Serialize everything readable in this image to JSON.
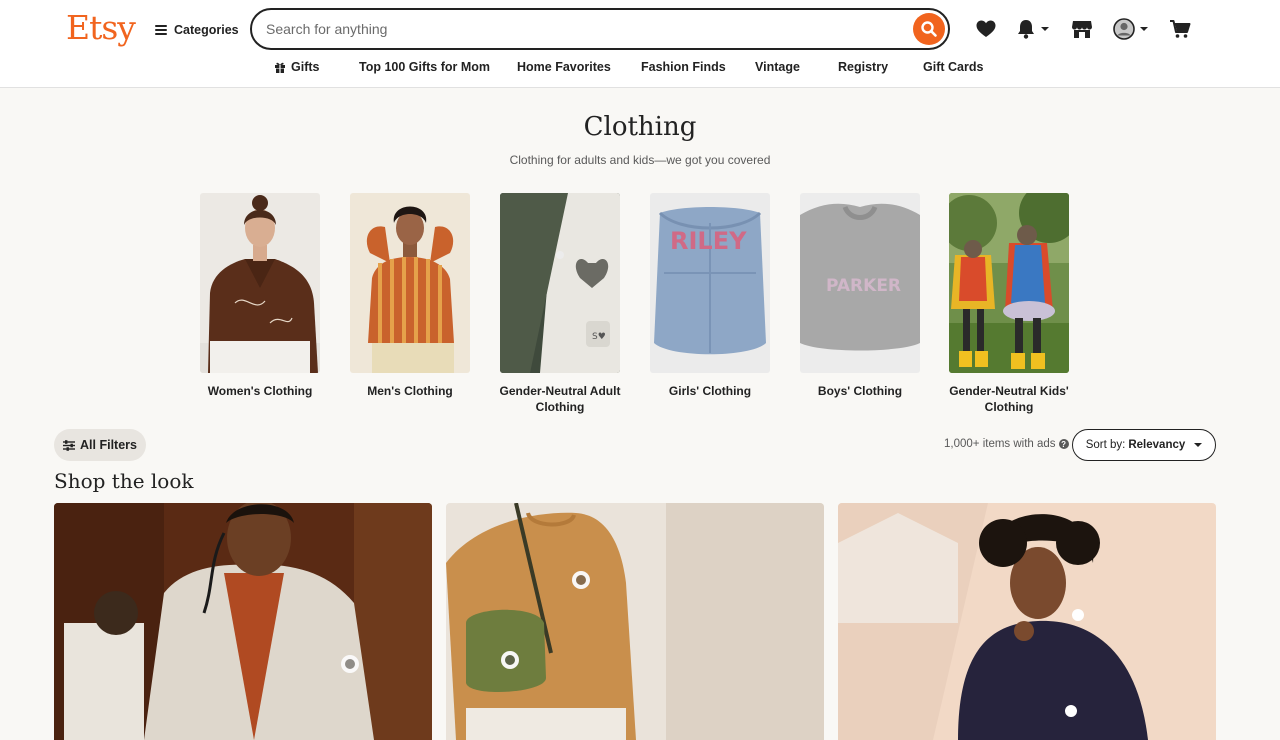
{
  "brand": {
    "logo": "Etsy",
    "color": "#f1641e"
  },
  "header": {
    "categories_label": "Categories",
    "search": {
      "placeholder": "Search for anything",
      "value": ""
    },
    "icons": [
      "favorites-heart-icon",
      "notifications-bell-icon",
      "shop-manager-icon",
      "account-avatar-icon",
      "cart-icon"
    ]
  },
  "subnav": {
    "items": [
      {
        "label": "Gifts",
        "icon": "gift-icon"
      },
      {
        "label": "Top 100 Gifts for Mom"
      },
      {
        "label": "Home Favorites"
      },
      {
        "label": "Fashion Finds"
      },
      {
        "label": "Vintage"
      },
      {
        "label": "Registry"
      },
      {
        "label": "Gift Cards"
      }
    ]
  },
  "page": {
    "title": "Clothing",
    "subtitle": "Clothing for adults and kids—we got you covered"
  },
  "categories": [
    {
      "label": "Women's Clothing"
    },
    {
      "label": "Men's Clothing"
    },
    {
      "label": "Gender-Neutral Adult Clothing"
    },
    {
      "label": "Girls' Clothing",
      "image_text": "RILEY"
    },
    {
      "label": "Boys' Clothing",
      "image_text": "PARKER"
    },
    {
      "label": "Gender-Neutral Kids' Clothing"
    }
  ],
  "filters": {
    "all_filters_label": "All Filters",
    "result_count": "1,000+ items with ads",
    "sort_prefix": "Sort by:",
    "sort_value": "Relevancy"
  },
  "shop_the_look": {
    "title": "Shop the look"
  }
}
